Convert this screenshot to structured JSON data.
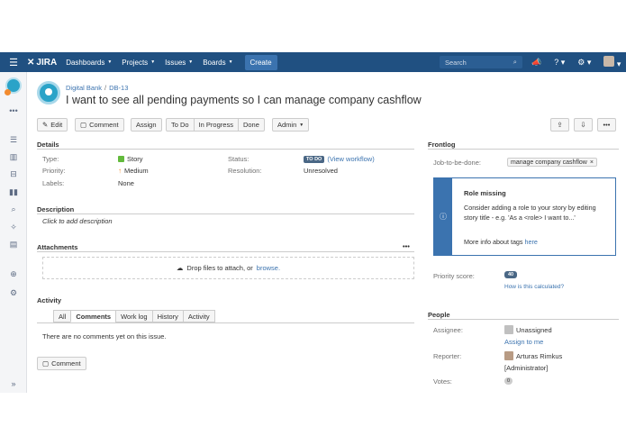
{
  "nav": {
    "logo": "JIRA",
    "items": [
      "Dashboards",
      "Projects",
      "Issues",
      "Boards"
    ],
    "create": "Create",
    "search_placeholder": "Search"
  },
  "breadcrumb": {
    "project": "Digital Bank",
    "separator": "/",
    "key": "DB-13"
  },
  "issue_title": "I want to see all pending payments so I can manage company cashflow",
  "toolbar": {
    "edit": "Edit",
    "comment": "Comment",
    "assign": "Assign",
    "workflow": [
      "To Do",
      "In Progress",
      "Done"
    ],
    "admin": "Admin"
  },
  "details": {
    "heading": "Details",
    "type_label": "Type:",
    "type_value": "Story",
    "priority_label": "Priority:",
    "priority_value": "Medium",
    "labels_label": "Labels:",
    "labels_value": "None",
    "status_label": "Status:",
    "status_value": "TO DO",
    "view_workflow": "(View workflow)",
    "resolution_label": "Resolution:",
    "resolution_value": "Unresolved"
  },
  "description": {
    "heading": "Description",
    "placeholder": "Click to add description"
  },
  "attachments": {
    "heading": "Attachments",
    "drop_text": "Drop files to attach, or",
    "browse": "browse."
  },
  "activity": {
    "heading": "Activity",
    "tabs": [
      "All",
      "Comments",
      "Work log",
      "History",
      "Activity"
    ],
    "empty": "There are no comments yet on this issue.",
    "comment_button": "Comment"
  },
  "frontlog": {
    "heading": "Frontlog",
    "jtbd_label": "Job-to-be-done:",
    "tag": "manage company cashflow",
    "role_title": "Role missing",
    "role_text": "Consider adding a role to your story by editing story title - e.g. 'As a <role> I want to...'",
    "more_text": "More info about tags",
    "more_link": "here",
    "score_label": "Priority score:",
    "score_value": "40",
    "score_link": "How is this calculated?"
  },
  "people": {
    "heading": "People",
    "assignee_label": "Assignee:",
    "assignee_value": "Unassigned",
    "assign_me": "Assign to me",
    "reporter_label": "Reporter:",
    "reporter_value": "Arturas Rimkus",
    "reporter_role": "[Administrator]",
    "votes_label": "Votes:",
    "votes_value": "0"
  },
  "colors": {
    "nav": "#205081",
    "link": "#3b73af",
    "badge": "#4a6785"
  }
}
